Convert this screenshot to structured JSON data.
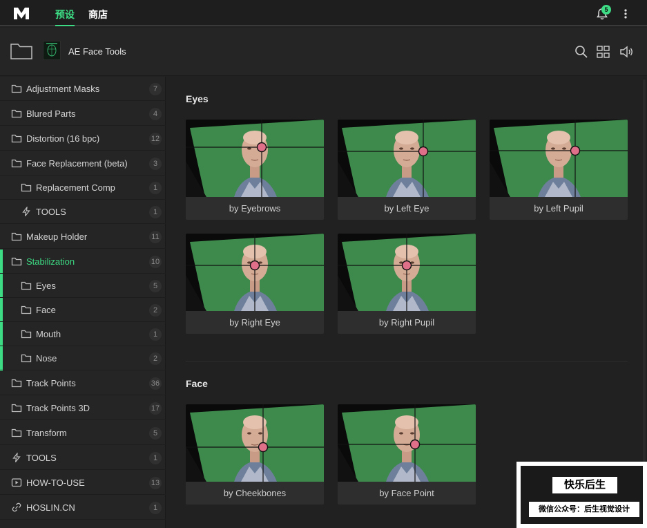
{
  "topbar": {
    "tabs": [
      {
        "label": "预设",
        "active": true
      },
      {
        "label": "商店",
        "active": false
      }
    ],
    "notification_count": "5",
    "accent_color": "#3ddc84"
  },
  "header": {
    "title": "AE Face Tools"
  },
  "sidebar": {
    "items": [
      {
        "label": "Adjustment Masks",
        "count": "7",
        "icon": "folder-icon"
      },
      {
        "label": "Blured Parts",
        "count": "4",
        "icon": "folder-icon"
      },
      {
        "label": "Distortion (16 bpc)",
        "count": "12",
        "icon": "folder-icon"
      },
      {
        "label": "Face Replacement (beta)",
        "count": "3",
        "icon": "folder-icon"
      },
      {
        "label": "Replacement Comp",
        "count": "1",
        "icon": "folder-icon"
      },
      {
        "label": "TOOLS",
        "count": "1",
        "icon": "lightning-icon"
      },
      {
        "label": "Makeup Holder",
        "count": "11",
        "icon": "folder-icon"
      },
      {
        "label": "Stabilization",
        "count": "10",
        "icon": "folder-icon"
      },
      {
        "label": "Eyes",
        "count": "5",
        "icon": "folder-icon"
      },
      {
        "label": "Face",
        "count": "2",
        "icon": "folder-icon"
      },
      {
        "label": "Mouth",
        "count": "1",
        "icon": "folder-icon"
      },
      {
        "label": "Nose",
        "count": "2",
        "icon": "folder-icon"
      },
      {
        "label": "Track Points",
        "count": "36",
        "icon": "folder-icon"
      },
      {
        "label": "Track Points 3D",
        "count": "17",
        "icon": "folder-icon"
      },
      {
        "label": "Transform",
        "count": "5",
        "icon": "folder-icon"
      },
      {
        "label": "TOOLS",
        "count": "1",
        "icon": "lightning-icon"
      },
      {
        "label": "HOW-TO-USE",
        "count": "13",
        "icon": "play-icon"
      },
      {
        "label": "HOSLIN.CN",
        "count": "1",
        "icon": "link-icon"
      }
    ]
  },
  "main": {
    "sections": [
      {
        "title": "Eyes",
        "cards": [
          "by Eyebrows",
          "by Left Eye",
          "by Left Pupil",
          "by Right Eye",
          "by Right Pupil"
        ]
      },
      {
        "title": "Face",
        "cards": [
          "by Cheekbones",
          "by Face Point"
        ]
      }
    ]
  },
  "watermark": {
    "line1": "快乐后生",
    "line2": "微信公众号：后生视觉设计"
  }
}
